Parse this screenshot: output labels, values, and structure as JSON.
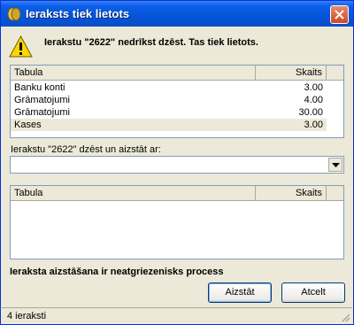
{
  "window": {
    "title": "Ieraksts tiek lietots"
  },
  "message": "Ierakstu \"2622\" nedrīkst dzēst. Tas tiek lietots.",
  "usage_table": {
    "columns": [
      "Tabula",
      "Skaits"
    ],
    "rows": [
      {
        "table": "Banku konti",
        "count": "3.00"
      },
      {
        "table": "Grāmatojumi",
        "count": "4.00"
      },
      {
        "table": "Grāmatojumi",
        "count": "30.00"
      },
      {
        "table": "Kases",
        "count": "3.00"
      }
    ]
  },
  "replace_label": "Ierakstu \"2622\" dzēst un aizstāt ar:",
  "replace_combo": {
    "value": ""
  },
  "replace_table": {
    "columns": [
      "Tabula",
      "Skaits"
    ],
    "rows": []
  },
  "warning_text": "Ieraksta aizstāšana ir neatgriezenisks process",
  "buttons": {
    "replace": "Aizstāt",
    "cancel": "Atcelt"
  },
  "status": "4 ieraksti"
}
